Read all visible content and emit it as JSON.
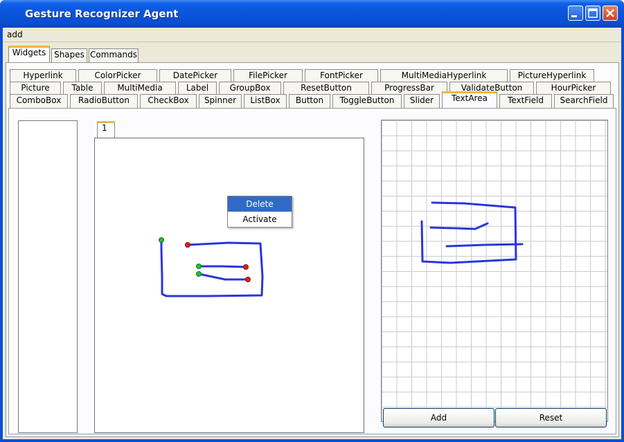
{
  "window": {
    "title": "Gesture Recognizer Agent"
  },
  "menubar": {
    "items": [
      "add"
    ]
  },
  "main_tabs": [
    {
      "label": "Widgets",
      "active": true
    },
    {
      "label": "Shapes",
      "active": false
    },
    {
      "label": "Commands",
      "active": false
    }
  ],
  "widget_tabs": {
    "row1": [
      "Hyperlink",
      "ColorPicker",
      "DatePicker",
      "FilePicker",
      "FontPicker",
      "MultiMediaHyperlink",
      "PictureHyperlink"
    ],
    "row2": [
      "Picture",
      "Table",
      "MultiMedia",
      "Label",
      "GroupBox",
      "ResetButton",
      "ProgressBar",
      "ValidateButton",
      "HourPicker"
    ],
    "row3": [
      "ComboBox",
      "RadioButton",
      "CheckBox",
      "Spinner",
      "ListBox",
      "Button",
      "ToggleButton",
      "Slider",
      "TextArea",
      "TextField",
      "SearchField"
    ],
    "active": "TextArea"
  },
  "gesture_tabs": [
    {
      "label": "1",
      "active": true
    }
  ],
  "context_menu": {
    "items": [
      "Delete",
      "Activate"
    ],
    "selected": "Delete"
  },
  "buttons": {
    "add": "Add",
    "reset": "Reset"
  },
  "colors": {
    "stroke": "#2a36d8",
    "start_point": "#22c03a",
    "end_point": "#e02020",
    "selection": "#316ac5",
    "titlebar": "#0b55dc"
  }
}
